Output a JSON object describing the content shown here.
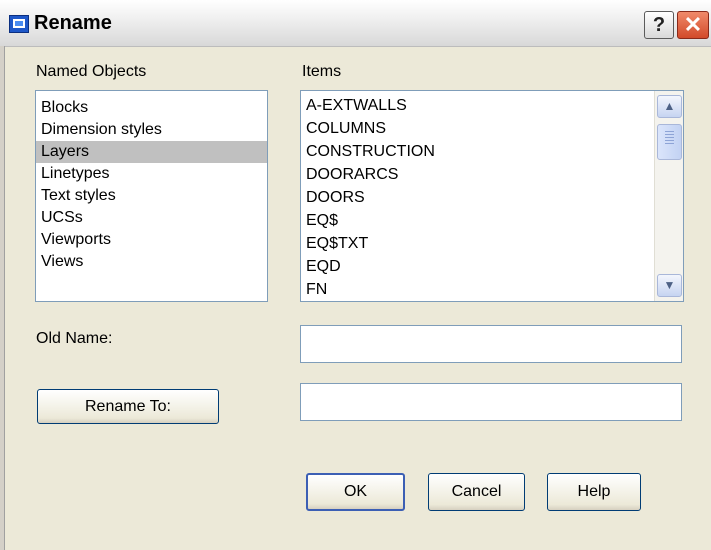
{
  "window": {
    "title": "Rename"
  },
  "named_objects": {
    "label": "Named Objects",
    "items": [
      "Blocks",
      "Dimension styles",
      "Layers",
      "Linetypes",
      "Text styles",
      "UCSs",
      "Viewports",
      "Views"
    ],
    "selected": "Layers"
  },
  "items": {
    "label": "Items",
    "list": [
      "A-EXTWALLS",
      "COLUMNS",
      "CONSTRUCTION",
      "DOORARCS",
      "DOORS",
      "EQ$",
      "EQ$TXT",
      "EQD",
      "FN"
    ]
  },
  "old_name": {
    "label": "Old Name:",
    "value": ""
  },
  "rename_to": {
    "button_label": "Rename To:",
    "value": ""
  },
  "buttons": {
    "ok": "OK",
    "cancel": "Cancel",
    "help": "Help"
  },
  "icons": {
    "title_help": "?",
    "title_close": "✕",
    "scroll_up": "▲",
    "scroll_down": "▼"
  }
}
